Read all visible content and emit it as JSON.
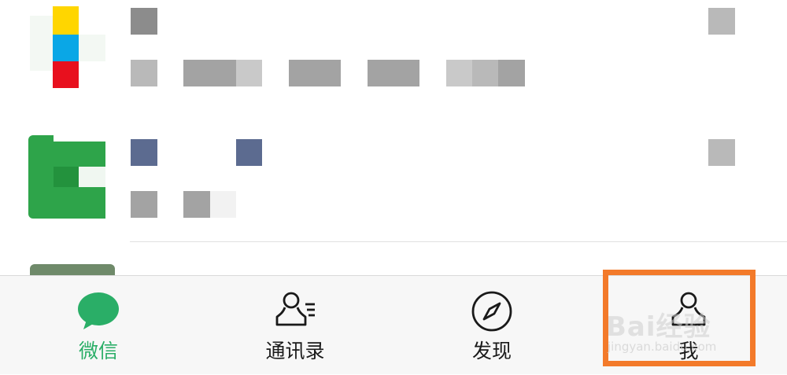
{
  "tabs": [
    {
      "label": "微信",
      "icon": "chat-bubble-icon",
      "active": true
    },
    {
      "label": "通讯录",
      "icon": "contacts-icon",
      "active": false
    },
    {
      "label": "发现",
      "icon": "compass-icon",
      "active": false
    },
    {
      "label": "我",
      "icon": "person-icon",
      "active": false
    }
  ],
  "watermark": {
    "brand": "Bai经验",
    "url": "jingyan.baidu.com"
  },
  "colors": {
    "accent_green": "#2aae67",
    "highlight_orange": "#f37a2a",
    "tabbar_bg": "#f7f7f7"
  }
}
